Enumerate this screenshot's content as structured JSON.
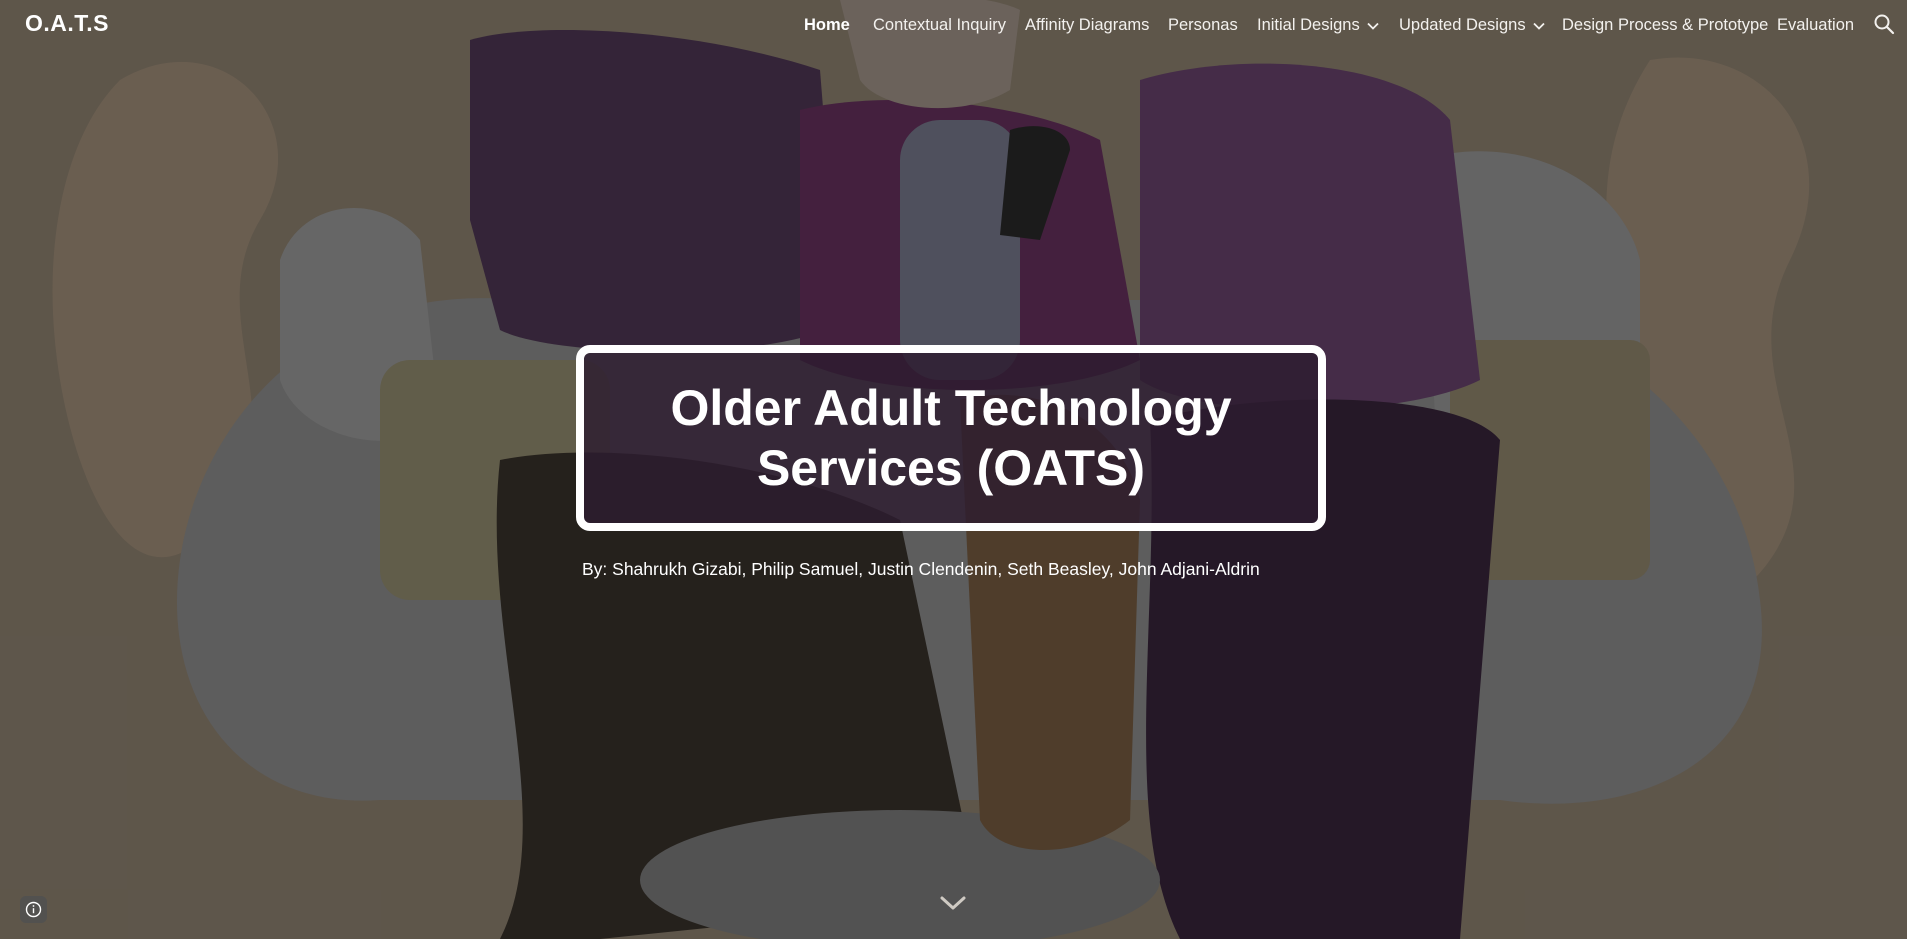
{
  "site": {
    "title": "O.A.T.S"
  },
  "nav": {
    "items": [
      {
        "label": "Home",
        "active": true,
        "dropdown": false
      },
      {
        "label": "Contextual Inquiry",
        "active": false,
        "dropdown": false
      },
      {
        "label": "Affinity Diagrams",
        "active": false,
        "dropdown": false
      },
      {
        "label": "Personas",
        "active": false,
        "dropdown": false
      },
      {
        "label": "Initial Designs",
        "active": false,
        "dropdown": true
      },
      {
        "label": "Updated Designs",
        "active": false,
        "dropdown": true
      },
      {
        "label": "Design Process & Prototype",
        "active": false,
        "dropdown": false
      },
      {
        "label": "Evaluation",
        "active": false,
        "dropdown": false
      }
    ],
    "search_icon": "search-icon"
  },
  "hero": {
    "title": "Older Adult Technology Services (OATS)",
    "authors": "By: Shahrukh Gizabi, Philip Samuel, Justin Clendenin, Seth Beasley, John Adjani-Aldrin",
    "info_icon": "info-icon",
    "scroll_icon": "chevron-down-icon"
  },
  "colors": {
    "background": "#6e6557",
    "title_box": "#2d1c30",
    "text": "#ffffff"
  }
}
